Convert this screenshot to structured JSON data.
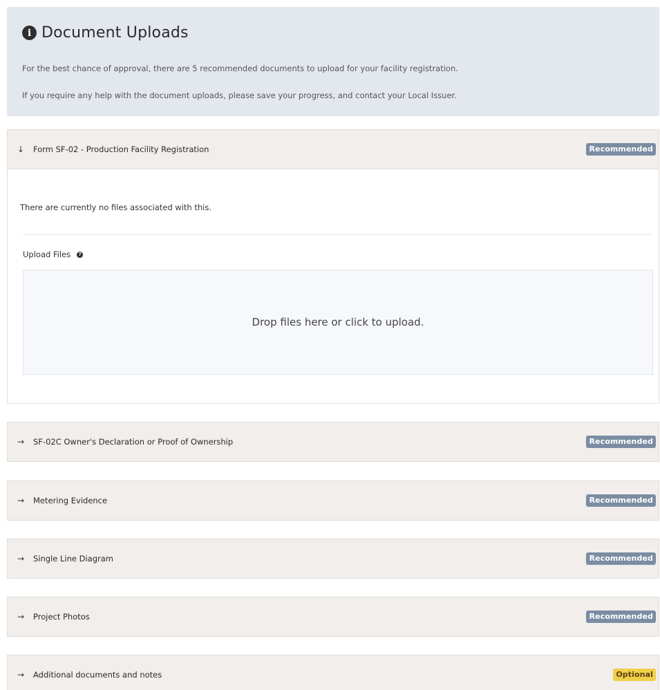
{
  "info_panel": {
    "icon": "info-icon",
    "title": "Document Uploads",
    "line1": "For the best chance of approval, there are 5 recommended documents to upload for your facility registration.",
    "line2": "If you require any help with the document uploads, please save your progress, and contact your Local Issuer."
  },
  "sections": [
    {
      "title": "Form SF-02 - Production Facility Registration",
      "badge": "Recommended",
      "expanded": true,
      "arrow_glyph": "↓"
    },
    {
      "title": "SF-02C Owner's Declaration or Proof of Ownership",
      "badge": "Recommended",
      "expanded": false,
      "arrow_glyph": "→"
    },
    {
      "title": "Metering Evidence",
      "badge": "Recommended",
      "expanded": false,
      "arrow_glyph": "→"
    },
    {
      "title": "Single Line Diagram",
      "badge": "Recommended",
      "expanded": false,
      "arrow_glyph": "→"
    },
    {
      "title": "Project Photos",
      "badge": "Recommended",
      "expanded": false,
      "arrow_glyph": "→"
    },
    {
      "title": "Additional documents and notes",
      "badge": "Optional",
      "expanded": false,
      "arrow_glyph": "→"
    }
  ],
  "expanded_body": {
    "no_files_text": "There are currently no files associated with this.",
    "upload_label": "Upload Files",
    "help_icon_glyph": "?",
    "dropzone_text": "Drop files here or click to upload."
  },
  "colors": {
    "info_panel_bg": "#e3e7ee",
    "section_header_bg": "#f1eeeb",
    "recommended_badge": "#7b8da3",
    "optional_badge": "#f0cf4b",
    "dropzone_bg": "#f6f8fb"
  }
}
